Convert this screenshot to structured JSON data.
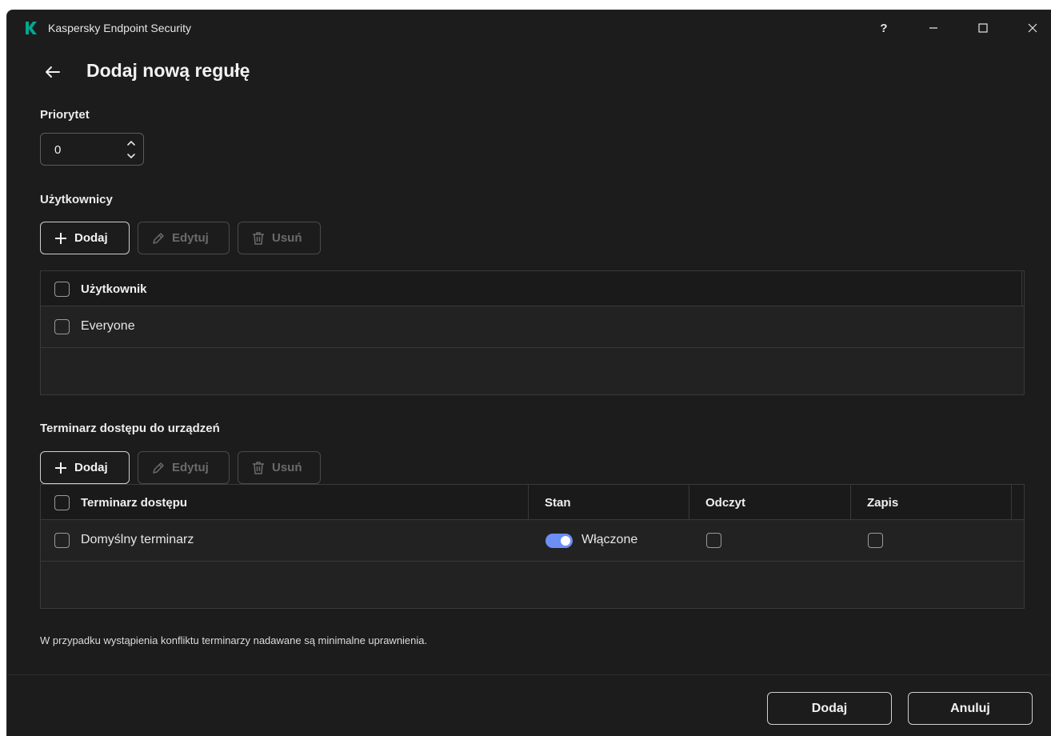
{
  "window": {
    "title": "Kaspersky Endpoint Security",
    "help_label": "?"
  },
  "page": {
    "title": "Dodaj nową regułę"
  },
  "priority": {
    "label": "Priorytet",
    "value": "0"
  },
  "users": {
    "label": "Użytkownicy",
    "toolbar": {
      "add": "Dodaj",
      "edit": "Edytuj",
      "delete": "Usuń"
    },
    "columns": [
      "Użytkownik"
    ],
    "rows": [
      {
        "name": "Everyone",
        "checked": false
      }
    ]
  },
  "schedules": {
    "label": "Terminarz dostępu do urządzeń",
    "toolbar": {
      "add": "Dodaj",
      "edit": "Edytuj",
      "delete": "Usuń"
    },
    "columns": [
      "Terminarz dostępu",
      "Stan",
      "Odczyt",
      "Zapis"
    ],
    "rows": [
      {
        "name": "Domyślny terminarz",
        "state": "Włączone",
        "enabled": true,
        "read": false,
        "write": false
      }
    ]
  },
  "info": "W przypadku wystąpienia konfliktu terminarzy nadawane są minimalne uprawnienia.",
  "footer": {
    "add": "Dodaj",
    "cancel": "Anuluj"
  },
  "colors": {
    "background": "#1c1c1c",
    "brand": "#00a88e",
    "toggle_on": "#6c8ef5"
  }
}
